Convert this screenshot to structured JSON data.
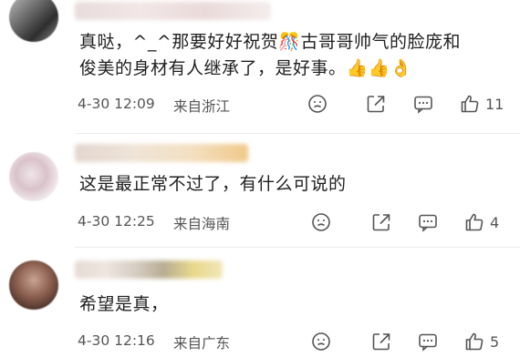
{
  "comments": [
    {
      "text_line1": "真哒，^_^那要好好祝贺🎊古哥哥帅气的脸庞和",
      "text_line2": "俊美的身材有人继承了，是好事。👍👍👌",
      "time": "4-30 12:09",
      "source": "来自浙江",
      "like_count": "11"
    },
    {
      "text_line1": "这是最正常不过了，有什么可说的",
      "time": "4-30 12:25",
      "source": "来自海南",
      "like_count": "4"
    },
    {
      "text_line1": "希望是真，",
      "time": "4-30 12:16",
      "source": "来自广东",
      "like_count": "5"
    }
  ],
  "icons": {
    "emotion": "emotion-icon",
    "share": "share-icon",
    "reply": "reply-icon",
    "like": "thumbs-up-icon"
  }
}
